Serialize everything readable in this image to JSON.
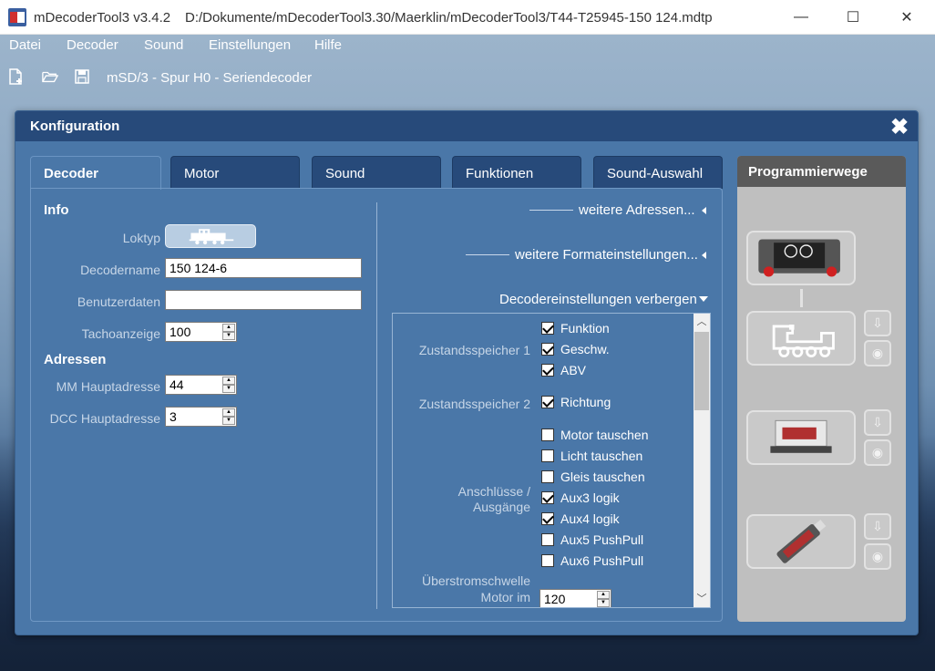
{
  "window": {
    "app_title": "mDecoderTool3   v3.4.2",
    "file_path": "D:/Dokumente/mDecoderTool3.30/Maerklin/mDecoderTool3/T44-T25945-150 124.mdtp",
    "minimize_symbol": "—",
    "maximize_symbol": "☐",
    "close_symbol": "✕"
  },
  "menu": [
    "Datei",
    "Decoder",
    "Sound",
    "Einstellungen",
    "Hilfe"
  ],
  "toolbar": {
    "title": "mSD/3 - Spur H0 - Seriendecoder"
  },
  "dialog": {
    "title": "Konfiguration",
    "close_symbol": "✖"
  },
  "tabs": [
    "Decoder",
    "Motor",
    "Sound",
    "Funktionen",
    "Sound-Auswahl"
  ],
  "info": {
    "heading": "Info",
    "loktyp_label": "Loktyp",
    "decodername_label": "Decodername",
    "decodername_value": "150 124-6",
    "benutzerdaten_label": "Benutzerdaten",
    "benutzerdaten_value": "",
    "tacho_label": "Tachoanzeige",
    "tacho_value": "100"
  },
  "adressen": {
    "heading": "Adressen",
    "mm_label": "MM Hauptadresse",
    "mm_value": "44",
    "dcc_label": "DCC Hauptadresse",
    "dcc_value": "3"
  },
  "links": {
    "weitere_adressen": "weitere Adressen...",
    "weitere_formate": "weitere Formateinstellungen...",
    "decodereinstellungen": "Decodereinstellungen verbergen"
  },
  "settings": {
    "zustand1_label": "Zustandsspeicher 1",
    "zustand2_label": "Zustandsspeicher 2",
    "anschluesse_label_1": "Anschlüsse /",
    "anschluesse_label_2": "Ausgänge",
    "ueberstrom_label_1": "Überstromschwelle",
    "ueberstrom_label_2": "Motor im",
    "ueberstrom_value": "120",
    "checkboxes": [
      {
        "label": "Funktion",
        "checked": true
      },
      {
        "label": "Geschw.",
        "checked": true
      },
      {
        "label": "ABV",
        "checked": true
      },
      {
        "label": "Richtung",
        "checked": true
      },
      {
        "label": "Motor tauschen",
        "checked": false
      },
      {
        "label": "Licht tauschen",
        "checked": false
      },
      {
        "label": "Gleis tauschen",
        "checked": false
      },
      {
        "label": "Aux3 logik",
        "checked": true
      },
      {
        "label": "Aux4 logik",
        "checked": true
      },
      {
        "label": "Aux5 PushPull",
        "checked": false
      },
      {
        "label": "Aux6 PushPull",
        "checked": false
      }
    ]
  },
  "programmierwege": {
    "heading": "Programmierwege"
  },
  "colors": {
    "dialog_bg": "#4a77a8",
    "header_bg": "#274a7a",
    "side_panel_bg": "#bfbfbf"
  }
}
